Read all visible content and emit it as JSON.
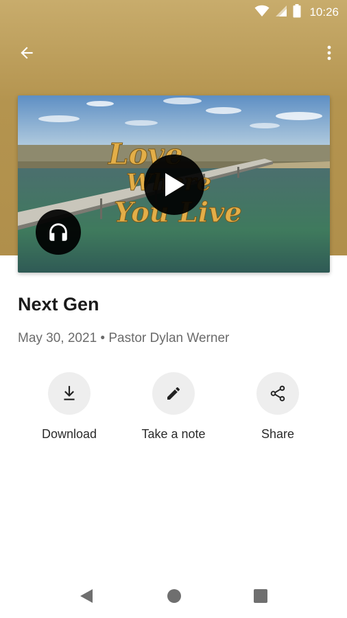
{
  "status_bar": {
    "time": "10:26",
    "icons": [
      "wifi-icon",
      "signal-icon",
      "battery-icon"
    ]
  },
  "toolbar": {
    "back_icon": "arrow-back-icon",
    "menu_icon": "more-vert-icon"
  },
  "media": {
    "thumbnail_text_line1": "Love",
    "thumbnail_text_line2": "Where",
    "thumbnail_text_line3": "You Live",
    "play_icon": "play-icon",
    "audio_icon": "headphones-icon"
  },
  "sermon": {
    "title": "Next Gen",
    "meta": "May 30, 2021 • Pastor Dylan Werner"
  },
  "actions": [
    {
      "label": "Download",
      "icon": "download-icon"
    },
    {
      "label": "Take a note",
      "icon": "pencil-icon"
    },
    {
      "label": "Share",
      "icon": "share-icon"
    }
  ],
  "nav_bar": {
    "icons": [
      "back-triangle-icon",
      "home-circle-icon",
      "recents-square-icon"
    ]
  },
  "colors": {
    "header_gold": "#b4944f",
    "title_text": "#1b1b1b",
    "meta_text": "#6b6b6b",
    "action_circle": "#eeeeee",
    "thumbnail_lettering": "#e3ae48"
  }
}
